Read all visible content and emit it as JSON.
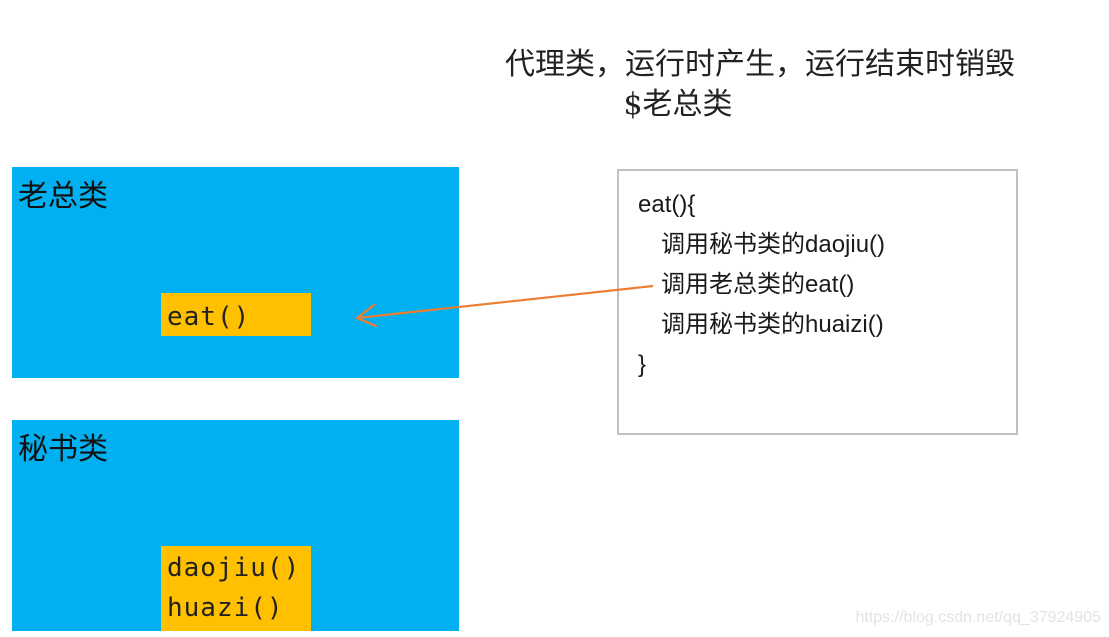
{
  "caption": {
    "line1": "代理类，运行时产生，运行结束时销毁",
    "line2": "$老总类"
  },
  "boss_class": {
    "title": "老总类",
    "methods": [
      "eat()"
    ]
  },
  "secretary_class": {
    "title": "秘书类",
    "methods": [
      "daojiu()",
      "huazi()"
    ]
  },
  "proxy_code": {
    "lines": [
      "eat(){",
      "调用秘书类的daojiu()",
      "调用老总类的eat()",
      "调用秘书类的huaizi()",
      "}"
    ]
  },
  "colors": {
    "class_box": "#00b0f0",
    "method_box": "#ffc000",
    "arrow": "#ed7d31",
    "proxy_border": "#bfbfbf"
  },
  "watermark": "https://blog.csdn.net/qq_37924905"
}
